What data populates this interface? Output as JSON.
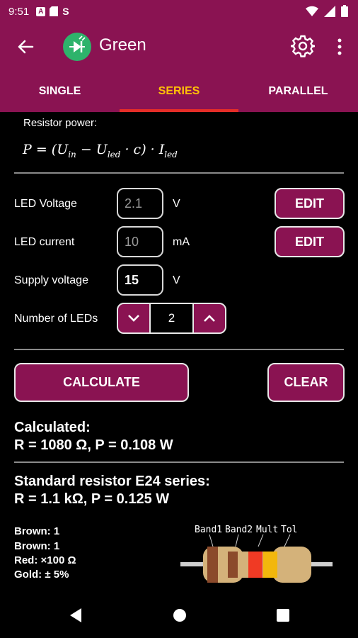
{
  "status_bar": {
    "time": "9:51",
    "icon_a": "A",
    "icon_s": "S"
  },
  "app_bar": {
    "title": "Green"
  },
  "tabs": [
    {
      "label": "SINGLE",
      "active": false
    },
    {
      "label": "SERIES",
      "active": true
    },
    {
      "label": "PARALLEL",
      "active": false
    }
  ],
  "formula": {
    "caption": "Resistor power:"
  },
  "form": {
    "led_voltage": {
      "label": "LED Voltage",
      "hint": "2.1",
      "unit": "V",
      "edit_label": "EDIT"
    },
    "led_current": {
      "label": "LED current",
      "hint": "10",
      "unit": "mA",
      "edit_label": "EDIT"
    },
    "supply_voltage": {
      "label": "Supply voltage",
      "value": "15",
      "unit": "V"
    },
    "number_of_leds": {
      "label": "Number of LEDs",
      "value": "2"
    }
  },
  "actions": {
    "calculate_label": "CALCULATE",
    "clear_label": "CLEAR"
  },
  "calculated": {
    "title": "Calculated:",
    "result": "R = 1080 Ω, P = 0.108 W"
  },
  "standard": {
    "title": "Standard resistor E24 series:",
    "result": "R = 1.1 kΩ, P = 0.125 W"
  },
  "bands": [
    {
      "text": "Brown: 1",
      "color": "#8b4a2b"
    },
    {
      "text": "Brown: 1",
      "color": "#8b4a2b"
    },
    {
      "text": "Red: ×100 Ω",
      "color": "#f03a24"
    },
    {
      "text": "Gold: ± 5%",
      "color": "#f2b70d"
    }
  ],
  "band_labels": [
    "Band1",
    "Band2",
    "Mult",
    "Tol"
  ],
  "colors": {
    "primary": "#8a1352",
    "accent_tab": "#ffc107",
    "indicator": "#e52d27",
    "resistor_body": "#d4b27a"
  }
}
